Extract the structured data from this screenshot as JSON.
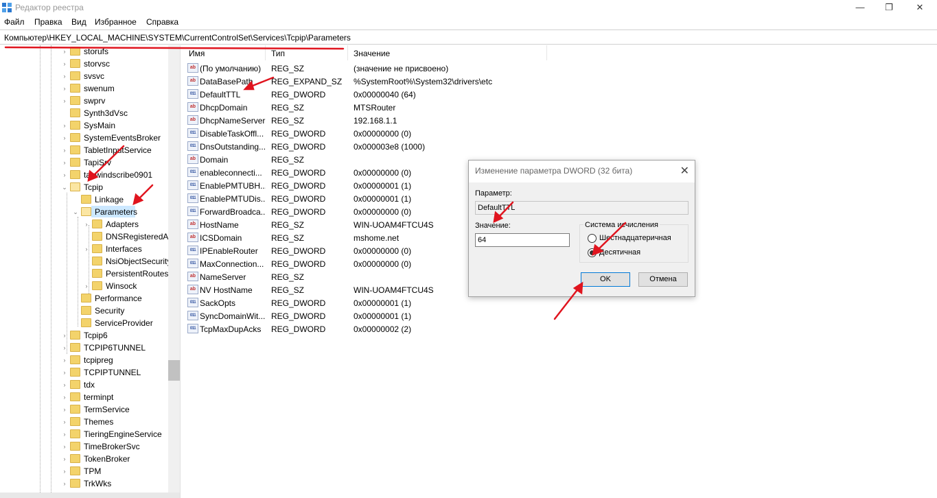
{
  "window": {
    "title": "Редактор реестра",
    "minimize_glyph": "—",
    "maximize_glyph": "❐",
    "close_glyph": "✕"
  },
  "menu": [
    "Файл",
    "Правка",
    "Вид",
    "Избранное",
    "Справка"
  ],
  "address": "Компьютер\\HKEY_LOCAL_MACHINE\\SYSTEM\\CurrentControlSet\\Services\\Tcpip\\Parameters",
  "tree": {
    "items": [
      {
        "label": "storufs",
        "level": 0,
        "expander": "›"
      },
      {
        "label": "storvsc",
        "level": 0,
        "expander": "›"
      },
      {
        "label": "svsvc",
        "level": 0,
        "expander": "›"
      },
      {
        "label": "swenum",
        "level": 0,
        "expander": "›"
      },
      {
        "label": "swprv",
        "level": 0,
        "expander": "›"
      },
      {
        "label": "Synth3dVsc",
        "level": 0,
        "expander": ""
      },
      {
        "label": "SysMain",
        "level": 0,
        "expander": "›"
      },
      {
        "label": "SystemEventsBroker",
        "level": 0,
        "expander": "›"
      },
      {
        "label": "TabletInputService",
        "level": 0,
        "expander": "›"
      },
      {
        "label": "TapiSrv",
        "level": 0,
        "expander": "›"
      },
      {
        "label": "tapwindscribe0901",
        "level": 0,
        "expander": "›"
      },
      {
        "label": "Tcpip",
        "level": 0,
        "expander": "⌄"
      },
      {
        "label": "Linkage",
        "level": 1,
        "expander": ""
      },
      {
        "label": "Parameters",
        "level": 1,
        "expander": "⌄",
        "selected": true
      },
      {
        "label": "Adapters",
        "level": 2,
        "expander": "›"
      },
      {
        "label": "DNSRegisteredAdapters",
        "level": 2,
        "expander": ""
      },
      {
        "label": "Interfaces",
        "level": 2,
        "expander": "›"
      },
      {
        "label": "NsiObjectSecurity",
        "level": 2,
        "expander": ""
      },
      {
        "label": "PersistentRoutes",
        "level": 2,
        "expander": ""
      },
      {
        "label": "Winsock",
        "level": 2,
        "expander": "›"
      },
      {
        "label": "Performance",
        "level": 1,
        "expander": ""
      },
      {
        "label": "Security",
        "level": 1,
        "expander": ""
      },
      {
        "label": "ServiceProvider",
        "level": 1,
        "expander": ""
      },
      {
        "label": "Tcpip6",
        "level": 0,
        "expander": "›"
      },
      {
        "label": "TCPIP6TUNNEL",
        "level": 0,
        "expander": "›"
      },
      {
        "label": "tcpipreg",
        "level": 0,
        "expander": "›"
      },
      {
        "label": "TCPIPTUNNEL",
        "level": 0,
        "expander": "›"
      },
      {
        "label": "tdx",
        "level": 0,
        "expander": "›"
      },
      {
        "label": "terminpt",
        "level": 0,
        "expander": "›"
      },
      {
        "label": "TermService",
        "level": 0,
        "expander": "›"
      },
      {
        "label": "Themes",
        "level": 0,
        "expander": "›"
      },
      {
        "label": "TieringEngineService",
        "level": 0,
        "expander": "›"
      },
      {
        "label": "TimeBrokerSvc",
        "level": 0,
        "expander": "›"
      },
      {
        "label": "TokenBroker",
        "level": 0,
        "expander": "›"
      },
      {
        "label": "TPM",
        "level": 0,
        "expander": "›"
      },
      {
        "label": "TrkWks",
        "level": 0,
        "expander": "›"
      }
    ]
  },
  "list": {
    "columns": [
      "Имя",
      "Тип",
      "Значение"
    ],
    "rows": [
      {
        "icon": "ab",
        "name": "(По умолчанию)",
        "type": "REG_SZ",
        "value": "(значение не присвоено)"
      },
      {
        "icon": "ab",
        "name": "DataBasePath",
        "type": "REG_EXPAND_SZ",
        "value": "%SystemRoot%\\System32\\drivers\\etc"
      },
      {
        "icon": "dw",
        "name": "DefaultTTL",
        "type": "REG_DWORD",
        "value": "0x00000040 (64)"
      },
      {
        "icon": "ab",
        "name": "DhcpDomain",
        "type": "REG_SZ",
        "value": "MTSRouter"
      },
      {
        "icon": "ab",
        "name": "DhcpNameServer",
        "type": "REG_SZ",
        "value": "192.168.1.1"
      },
      {
        "icon": "dw",
        "name": "DisableTaskOffl...",
        "type": "REG_DWORD",
        "value": "0x00000000 (0)"
      },
      {
        "icon": "dw",
        "name": "DnsOutstanding...",
        "type": "REG_DWORD",
        "value": "0x000003e8 (1000)"
      },
      {
        "icon": "ab",
        "name": "Domain",
        "type": "REG_SZ",
        "value": ""
      },
      {
        "icon": "dw",
        "name": "enableconnecti...",
        "type": "REG_DWORD",
        "value": "0x00000000 (0)"
      },
      {
        "icon": "dw",
        "name": "EnablePMTUBH...",
        "type": "REG_DWORD",
        "value": "0x00000001 (1)"
      },
      {
        "icon": "dw",
        "name": "EnablePMTUDis...",
        "type": "REG_DWORD",
        "value": "0x00000001 (1)"
      },
      {
        "icon": "dw",
        "name": "ForwardBroadca...",
        "type": "REG_DWORD",
        "value": "0x00000000 (0)"
      },
      {
        "icon": "ab",
        "name": "HostName",
        "type": "REG_SZ",
        "value": "WIN-UOAM4FTCU4S"
      },
      {
        "icon": "ab",
        "name": "ICSDomain",
        "type": "REG_SZ",
        "value": "mshome.net"
      },
      {
        "icon": "dw",
        "name": "IPEnableRouter",
        "type": "REG_DWORD",
        "value": "0x00000000 (0)"
      },
      {
        "icon": "dw",
        "name": "MaxConnection...",
        "type": "REG_DWORD",
        "value": "0x00000000 (0)"
      },
      {
        "icon": "ab",
        "name": "NameServer",
        "type": "REG_SZ",
        "value": ""
      },
      {
        "icon": "ab",
        "name": "NV HostName",
        "type": "REG_SZ",
        "value": "WIN-UOAM4FTCU4S"
      },
      {
        "icon": "dw",
        "name": "SackOpts",
        "type": "REG_DWORD",
        "value": "0x00000001 (1)"
      },
      {
        "icon": "dw",
        "name": "SyncDomainWit...",
        "type": "REG_DWORD",
        "value": "0x00000001 (1)"
      },
      {
        "icon": "dw",
        "name": "TcpMaxDupAcks",
        "type": "REG_DWORD",
        "value": "0x00000002 (2)"
      }
    ]
  },
  "dialog": {
    "title": "Изменение параметра DWORD (32 бита)",
    "close_glyph": "✕",
    "param_label": "Параметр:",
    "param_value": "DefaultTTL",
    "value_label": "Значение:",
    "value_value": "64",
    "base_label": "Система исчисления",
    "radio_hex": "Шестнадцатеричная",
    "radio_dec": "Десятичная",
    "ok": "OK",
    "cancel": "Отмена"
  },
  "colors": {
    "selection": "#cce8ff",
    "annotation_arrow": "#e0141e",
    "folder": "#f3d36b"
  }
}
